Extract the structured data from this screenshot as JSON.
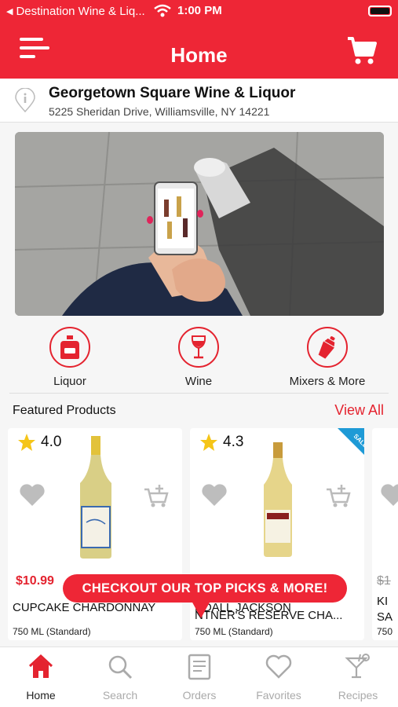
{
  "status_bar": {
    "back_app": "Destination Wine & Liq...",
    "time": "1:00 PM"
  },
  "header": {
    "title": "Home",
    "menu_icon": "hamburger-menu-icon",
    "cart_icon": "shopping-cart-icon"
  },
  "store": {
    "name": "Georgetown Square Wine & Liquor",
    "address": "5225 Sheridan Drive, Williamsville, NY 14221",
    "icon": "location-info-icon"
  },
  "categories": [
    {
      "label": "Liquor",
      "icon": "liquor-bottle-icon"
    },
    {
      "label": "Wine",
      "icon": "wine-glass-icon"
    },
    {
      "label": "Mixers & More",
      "icon": "cocktail-shaker-icon"
    }
  ],
  "featured": {
    "title": "Featured Products",
    "view_all": "View All",
    "products": [
      {
        "rating": "4.0",
        "price": "$10.99",
        "name": "CUPCAKE CHARDONNAY",
        "size": "750 ML (Standard)",
        "sale": false
      },
      {
        "rating": "4.3",
        "price": "",
        "name": "...NDALL JACKSON ...TNER'S RESERVE CHA...",
        "name_line1": "NDALL JACKSON",
        "name_line2": "NTNER'S RESERVE CHA...",
        "size": "750 ML (Standard)",
        "sale": true,
        "sale_text": "SALE"
      },
      {
        "rating": "",
        "price": "$1",
        "name_line1": "KI",
        "name_line2": "SA",
        "size": "750"
      }
    ]
  },
  "promo": {
    "text": "CHECKOUT OUR TOP PICKS & MORE!"
  },
  "tabs": [
    {
      "label": "Home",
      "icon": "home-icon",
      "active": true
    },
    {
      "label": "Search",
      "icon": "search-icon",
      "active": false
    },
    {
      "label": "Orders",
      "icon": "orders-icon",
      "active": false
    },
    {
      "label": "Favorites",
      "icon": "heart-icon",
      "active": false
    },
    {
      "label": "Recipes",
      "icon": "cocktail-glass-icon",
      "active": false
    }
  ],
  "colors": {
    "brand_red": "#ee2636",
    "star": "#f5c518",
    "sale_badge": "#1e9ad6"
  }
}
